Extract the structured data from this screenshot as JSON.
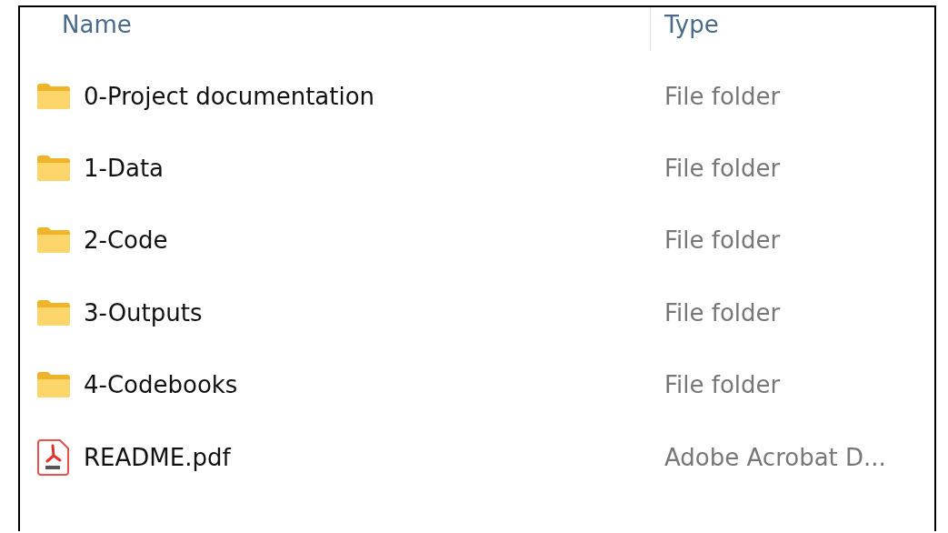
{
  "columns": [
    "Name",
    "Type"
  ],
  "files": [
    {
      "name": "0-Project documentation",
      "type": "File folder",
      "kind": "folder"
    },
    {
      "name": "1-Data",
      "type": "File folder",
      "kind": "folder"
    },
    {
      "name": "2-Code",
      "type": "File folder",
      "kind": "folder"
    },
    {
      "name": "3-Outputs",
      "type": "File folder",
      "kind": "folder"
    },
    {
      "name": "4-Codebooks",
      "type": "File folder",
      "kind": "folder"
    },
    {
      "name": "README.pdf",
      "type": "Adobe Acrobat D...",
      "kind": "pdf"
    }
  ]
}
